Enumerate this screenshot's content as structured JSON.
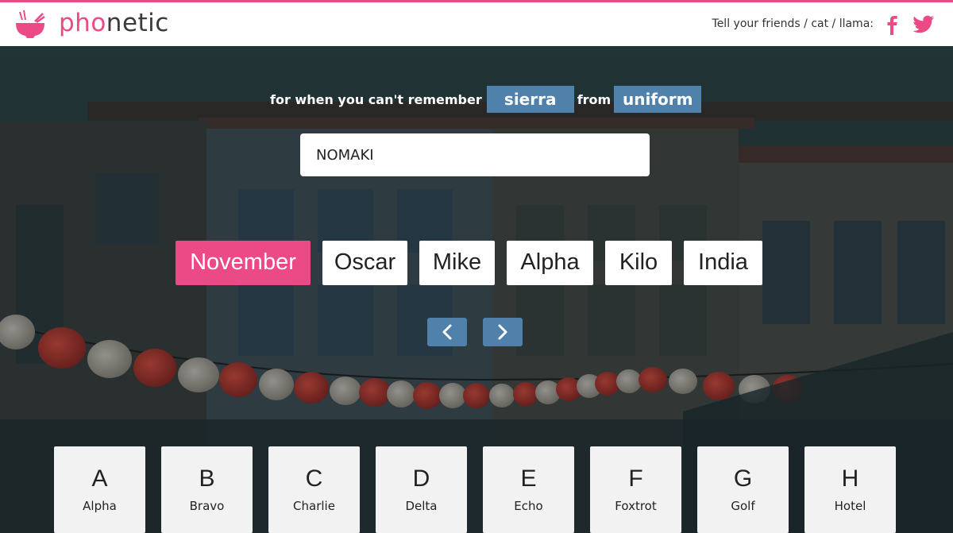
{
  "brand": {
    "prefix": "pho",
    "suffix": "netic",
    "accent": "#ec4a87"
  },
  "header": {
    "share_text": "Tell your friends / cat / llama:",
    "icons": [
      "noodle-bowl-icon",
      "facebook-icon",
      "twitter-icon"
    ]
  },
  "tagline": {
    "before": "for when you can't remember",
    "first": "sierra",
    "middle": "from",
    "second": "uniform"
  },
  "input": {
    "value": "NOMAKI"
  },
  "words": [
    "November",
    "Oscar",
    "Mike",
    "Alpha",
    "Kilo",
    "India"
  ],
  "active_word_index": 0,
  "nav": {
    "prev_icon": "chevron-left-icon",
    "next_icon": "chevron-right-icon"
  },
  "alphabet": [
    {
      "letter": "A",
      "word": "Alpha"
    },
    {
      "letter": "B",
      "word": "Bravo"
    },
    {
      "letter": "C",
      "word": "Charlie"
    },
    {
      "letter": "D",
      "word": "Delta"
    },
    {
      "letter": "E",
      "word": "Echo"
    },
    {
      "letter": "F",
      "word": "Foxtrot"
    },
    {
      "letter": "G",
      "word": "Golf"
    },
    {
      "letter": "H",
      "word": "Hotel"
    }
  ],
  "colors": {
    "accent_pink": "#ec4a87",
    "accent_blue": "#4f81ab",
    "card_bg": "#f2f2f2"
  }
}
